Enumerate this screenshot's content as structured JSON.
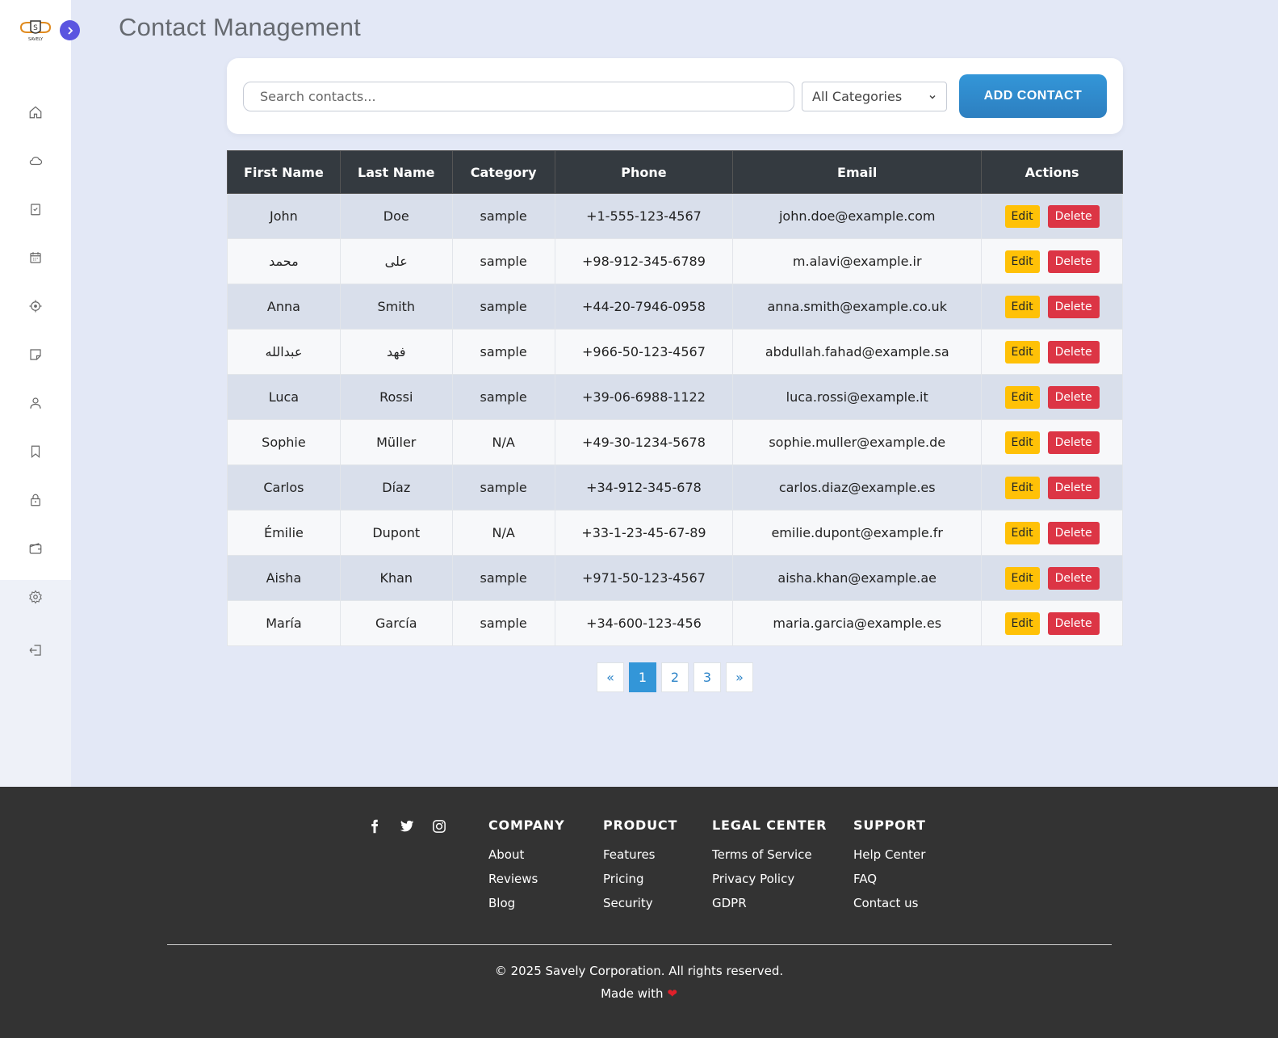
{
  "page": {
    "title": "Contact Management"
  },
  "logo": {
    "text": "SAVELY"
  },
  "toolbar": {
    "search_placeholder": "Search contacts...",
    "category_selected": "All Categories",
    "add_label": "ADD CONTACT"
  },
  "table": {
    "headers": [
      "First Name",
      "Last Name",
      "Category",
      "Phone",
      "Email",
      "Actions"
    ],
    "edit_label": "Edit",
    "delete_label": "Delete",
    "rows": [
      [
        "John",
        "Doe",
        "sample",
        "+1-555-123-4567",
        "john.doe@example.com"
      ],
      [
        "محمد",
        "علی",
        "sample",
        "+98-912-345-6789",
        "m.alavi@example.ir"
      ],
      [
        "Anna",
        "Smith",
        "sample",
        "+44-20-7946-0958",
        "anna.smith@example.co.uk"
      ],
      [
        "عبدالله",
        "فهد",
        "sample",
        "+966-50-123-4567",
        "abdullah.fahad@example.sa"
      ],
      [
        "Luca",
        "Rossi",
        "sample",
        "+39-06-6988-1122",
        "luca.rossi@example.it"
      ],
      [
        "Sophie",
        "Müller",
        "N/A",
        "+49-30-1234-5678",
        "sophie.muller@example.de"
      ],
      [
        "Carlos",
        "Díaz",
        "sample",
        "+34-912-345-678",
        "carlos.diaz@example.es"
      ],
      [
        "Émilie",
        "Dupont",
        "N/A",
        "+33-1-23-45-67-89",
        "emilie.dupont@example.fr"
      ],
      [
        "Aisha",
        "Khan",
        "sample",
        "+971-50-123-4567",
        "aisha.khan@example.ae"
      ],
      [
        "María",
        "García",
        "sample",
        "+34-600-123-456",
        "maria.garcia@example.es"
      ]
    ]
  },
  "pagination": {
    "prev": "«",
    "pages": [
      "1",
      "2",
      "3"
    ],
    "next": "»",
    "active": "1"
  },
  "sidebar": {
    "icons": [
      "home-icon",
      "cloud-icon",
      "clipboard-check-icon",
      "calendar-icon",
      "target-icon",
      "note-icon",
      "user-icon",
      "bookmark-icon",
      "lock-icon",
      "wallet-icon",
      "gear-icon",
      "logout-icon"
    ]
  },
  "footer": {
    "social": [
      "facebook-icon",
      "twitter-icon",
      "instagram-icon"
    ],
    "columns": [
      {
        "title": "COMPANY",
        "links": [
          "About",
          "Reviews",
          "Blog"
        ]
      },
      {
        "title": "PRODUCT",
        "links": [
          "Features",
          "Pricing",
          "Security"
        ]
      },
      {
        "title": "LEGAL CENTER",
        "links": [
          "Terms of Service",
          "Privacy Policy",
          "GDPR"
        ]
      },
      {
        "title": "SUPPORT",
        "links": [
          "Help Center",
          "FAQ",
          "Contact us"
        ]
      }
    ],
    "copyright": "© 2025 Savely Corporation. All rights reserved.",
    "made_with": "Made with",
    "heart": "❤"
  },
  "colors": {
    "accent": "#3396d8",
    "toggle": "#5a55e0",
    "edit": "#ffc107",
    "delete": "#dc3545",
    "footer_bg": "#333333"
  }
}
